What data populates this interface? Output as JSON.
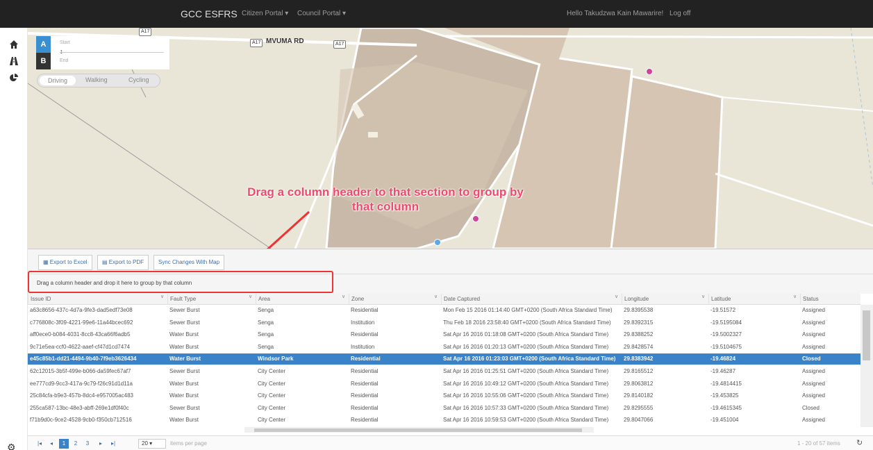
{
  "nav": {
    "brand": "GCC ESFRS",
    "citizen_portal": "Citizen Portal ▾",
    "council_portal": "Council Portal ▾",
    "greeting": "Hello Takudzwa Kain Mawarire!",
    "logoff": "Log off"
  },
  "sidebar": {
    "icons": [
      "home-icon",
      "road-icon",
      "pie-chart-icon"
    ],
    "settings_icon": "gear-icon"
  },
  "map": {
    "road_label": "MVUMA RD",
    "shields": [
      "A17",
      "A17",
      "A17"
    ],
    "route": {
      "start_letter": "A",
      "start_placeholder": "Start",
      "end_letter": "B",
      "end_placeholder": "End",
      "modes": [
        "Driving",
        "Walking",
        "Cycling"
      ],
      "active_mode": "Driving"
    },
    "annotation": "Drag a column header to that section to group by that column"
  },
  "toolbar": {
    "export_excel": "Export to Excel",
    "export_pdf": "Export to PDF",
    "sync": "Sync Changes With Map"
  },
  "grid": {
    "group_hint": "Drag a column header and drop it here to group by that column",
    "columns": [
      "Issue ID",
      "Fault Type",
      "Area",
      "Zone",
      "Date Captured",
      "Longitude",
      "Latitude",
      "Status"
    ],
    "selected_row": 4,
    "rows": [
      [
        "a63c8656-437c-4d7a-9fe3-dad5edf73e08",
        "Sewer Burst",
        "Senga",
        "Residential",
        "Mon Feb 15 2016 01:14:40 GMT+0200 (South Africa Standard Time)",
        "29.8395538",
        "-19.51572",
        "Assigned"
      ],
      [
        "c776808c-3f09-4221-99e6-11a44bcec692",
        "Sewer Burst",
        "Senga",
        "Institution",
        "Thu Feb 18 2016 23:58:40 GMT+0200 (South Africa Standard Time)",
        "29.8392315",
        "-19.5195084",
        "Assigned"
      ],
      [
        "aff0ece0-b084-4031-8cc8-43ca66f6adb5",
        "Water Burst",
        "Senga",
        "Residential",
        "Sat Apr 16 2016 01:18:08 GMT+0200 (South Africa Standard Time)",
        "29.8388252",
        "-19.5002327",
        "Assigned"
      ],
      [
        "9c71e5ea-ccf0-4622-aaef-cf47d1cd7474",
        "Water Burst",
        "Senga",
        "Institution",
        "Sat Apr 16 2016 01:20:13 GMT+0200 (South Africa Standard Time)",
        "29.8428574",
        "-19.5104675",
        "Assigned"
      ],
      [
        "e45c85b1-dd21-4494-9b40-7f9eb3626434",
        "Water Burst",
        "Windsor Park",
        "Residential",
        "Sat Apr 16 2016 01:23:03 GMT+0200 (South Africa Standard Time)",
        "29.8383942",
        "-19.46824",
        "Closed"
      ],
      [
        "62c12015-3b5f-499e-b066-da59fec67af7",
        "Sewer Burst",
        "City Center",
        "Residential",
        "Sat Apr 16 2016 01:25:51 GMT+0200 (South Africa Standard Time)",
        "29.8165512",
        "-19.46287",
        "Assigned"
      ],
      [
        "ee777cd9-9cc3-417a-9c79-f26c91d1d11a",
        "Water Burst",
        "City Center",
        "Residential",
        "Sat Apr 16 2016 10:49:12 GMT+0200 (South Africa Standard Time)",
        "29.8063812",
        "-19.4814415",
        "Assigned"
      ],
      [
        "25c84cfa-b9e3-457b-8dc4-e957005ac483",
        "Water Burst",
        "City Center",
        "Residential",
        "Sat Apr 16 2016 10:55:06 GMT+0200 (South Africa Standard Time)",
        "29.8140182",
        "-19.453825",
        "Assigned"
      ],
      [
        "255ca587-13bc-48e3-abff-269e1df0f40c",
        "Sewer Burst",
        "City Center",
        "Residential",
        "Sat Apr 16 2016 10:57:33 GMT+0200 (South Africa Standard Time)",
        "29.8295555",
        "-19.4615345",
        "Closed"
      ],
      [
        "f71b9d0c-9ce2-4528-9cb0-f350cb712516",
        "Water Burst",
        "City Center",
        "Residential",
        "Sat Apr 16 2016 10:59:53 GMT+0200 (South Africa Standard Time)",
        "29.8047066",
        "-19.451004",
        "Assigned"
      ]
    ]
  },
  "pager": {
    "first": "|◂",
    "prev": "◂",
    "pages": [
      "1",
      "2",
      "3"
    ],
    "current": "1",
    "next": "▸",
    "last": "▸|",
    "page_size": "20 ▾",
    "page_size_label": "items per page",
    "info": "1 - 20 of 57 items",
    "refresh_icon": "refresh-icon"
  }
}
